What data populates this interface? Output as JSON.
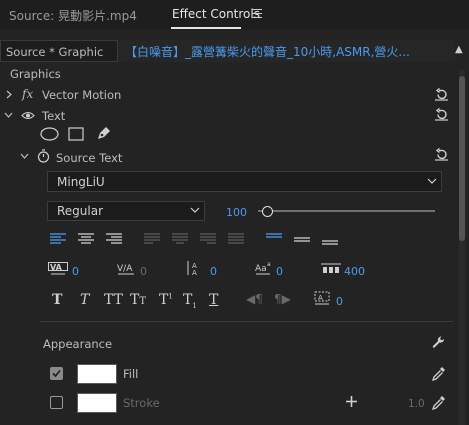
{
  "tabs": {
    "source": "Source: 晃動影片.mp4",
    "effect_controls": "Effect Controls"
  },
  "header": {
    "source_dropdown": "Source * Graphic",
    "clip_name": "【白噪音】_露營篝柴火的聲音_10小時,ASMR,營火..."
  },
  "section": {
    "graphics": "Graphics",
    "vector_motion": "Vector Motion",
    "text": "Text",
    "source_text": "Source Text",
    "appearance": "Appearance"
  },
  "font": {
    "family": "MingLiU",
    "style": "Regular",
    "size": "100"
  },
  "typography": {
    "kerning": "0",
    "tracking": "0",
    "leading": "0",
    "baseline_shift": "0",
    "tsume": "400",
    "tab_width": "0"
  },
  "appearance": {
    "fill_label": "Fill",
    "stroke_label": "Stroke",
    "stroke_width": "1.0",
    "fill_color": "#ffffff",
    "stroke_color": "#ffffff"
  },
  "icons": [
    "hamburger-icon",
    "reset-icon",
    "fx-icon",
    "eye-icon",
    "ellipse-tool-icon",
    "rectangle-tool-icon",
    "pen-tool-icon",
    "stopwatch-icon",
    "wrench-icon",
    "eyedropper-icon",
    "plus-icon"
  ],
  "colors": {
    "accent": "#4a9bf0",
    "background": "#232323"
  }
}
